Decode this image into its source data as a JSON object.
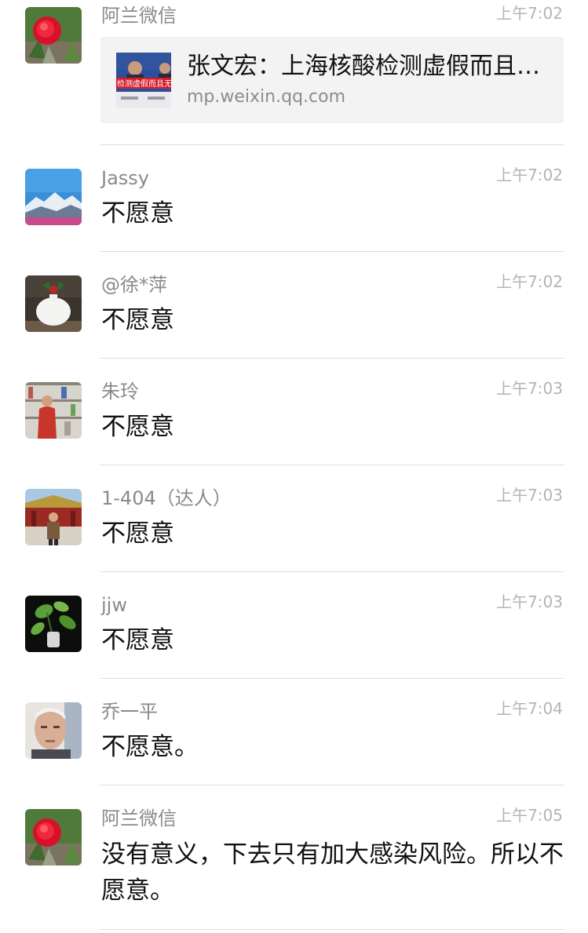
{
  "messages": [
    {
      "sender": "阿兰微信",
      "time": "上午7:02",
      "avatar_icon": "red-flower-avatar",
      "link_card": {
        "title": "张文宏：上海核酸检测虚假而且无效",
        "source": "mp.weixin.qq.com",
        "thumbnail_caption": "检测虚假而且无"
      }
    },
    {
      "sender": "Jassy",
      "time": "上午7:02",
      "text": "不愿意",
      "avatar_icon": "snow-mountain-avatar"
    },
    {
      "sender": "@徐*萍",
      "time": "上午7:02",
      "text": "不愿意",
      "avatar_icon": "white-vase-avatar"
    },
    {
      "sender": "朱玲",
      "time": "上午7:03",
      "text": "不愿意",
      "avatar_icon": "bookshelf-person-avatar"
    },
    {
      "sender": "1-404（达人）",
      "time": "上午7:03",
      "text": "不愿意",
      "avatar_icon": "palace-person-avatar"
    },
    {
      "sender": "jjw",
      "time": "上午7:03",
      "text": "不愿意",
      "avatar_icon": "green-plant-avatar"
    },
    {
      "sender": "乔一平",
      "time": "上午7:04",
      "text": "不愿意。",
      "avatar_icon": "elderly-man-avatar"
    },
    {
      "sender": "阿兰微信",
      "time": "上午7:05",
      "text": "没有意义，下去只有加大感染风险。所以不愿意。",
      "avatar_icon": "red-flower-avatar"
    }
  ],
  "colors": {
    "background": "#ffffff",
    "sender_name": "#8a8a8a",
    "timestamp": "#b4b4b4",
    "message_text": "#111111",
    "card_background": "#f3f3f3",
    "divider": "#dedede"
  }
}
